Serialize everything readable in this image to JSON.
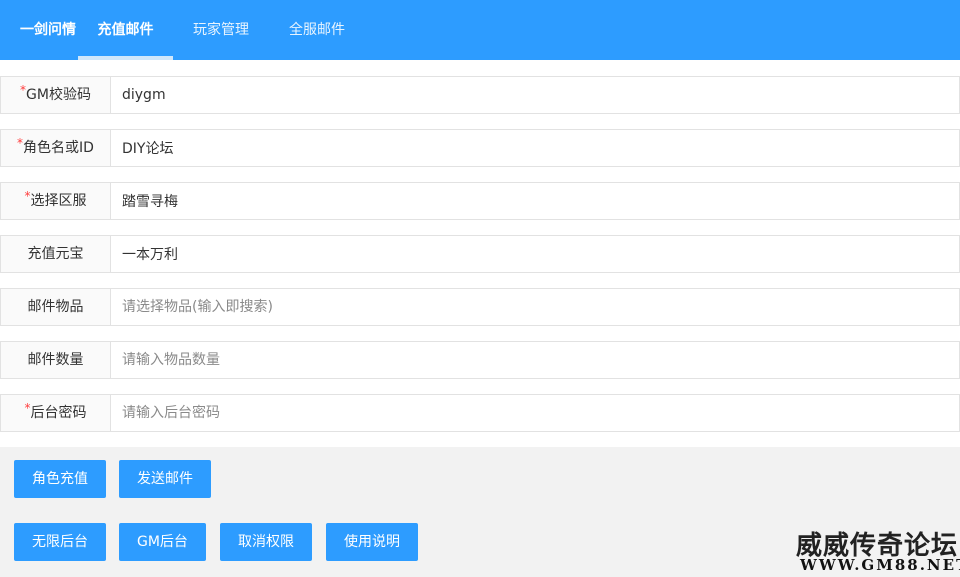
{
  "header": {
    "brand": "一剑问情",
    "tabs": [
      {
        "label": "充值邮件",
        "active": true
      },
      {
        "label": "玩家管理",
        "active": false
      },
      {
        "label": "全服邮件",
        "active": false
      }
    ]
  },
  "form": {
    "gm_code": {
      "label": "GM校验码",
      "required": "*",
      "value": "diygm",
      "placeholder": ""
    },
    "role": {
      "label": "角色名或ID",
      "required": "*",
      "value": "DIY论坛",
      "placeholder": ""
    },
    "server": {
      "label": "选择区服",
      "required": "*",
      "value": "踏雪寻梅",
      "placeholder": ""
    },
    "yuanbao": {
      "label": "充值元宝",
      "required": "",
      "value": "一本万利",
      "placeholder": ""
    },
    "item": {
      "label": "邮件物品",
      "required": "",
      "value": "",
      "placeholder": "请选择物品(输入即搜索)"
    },
    "quantity": {
      "label": "邮件数量",
      "required": "",
      "value": "",
      "placeholder": "请输入物品数量"
    },
    "password": {
      "label": "后台密码",
      "required": "*",
      "value": "",
      "placeholder": "请输入后台密码"
    }
  },
  "buttons": {
    "recharge": "角色充值",
    "send_mail": "发送邮件",
    "unlimited": "无限后台",
    "gm_admin": "GM后台",
    "revoke": "取消权限",
    "help": "使用说明"
  },
  "watermark": {
    "text": "威威传奇论坛",
    "url": "WWW.GM88.NET"
  },
  "colors": {
    "primary": "#2d9cff",
    "required": "#ff3b3b",
    "panel": "#f2f2f2"
  }
}
